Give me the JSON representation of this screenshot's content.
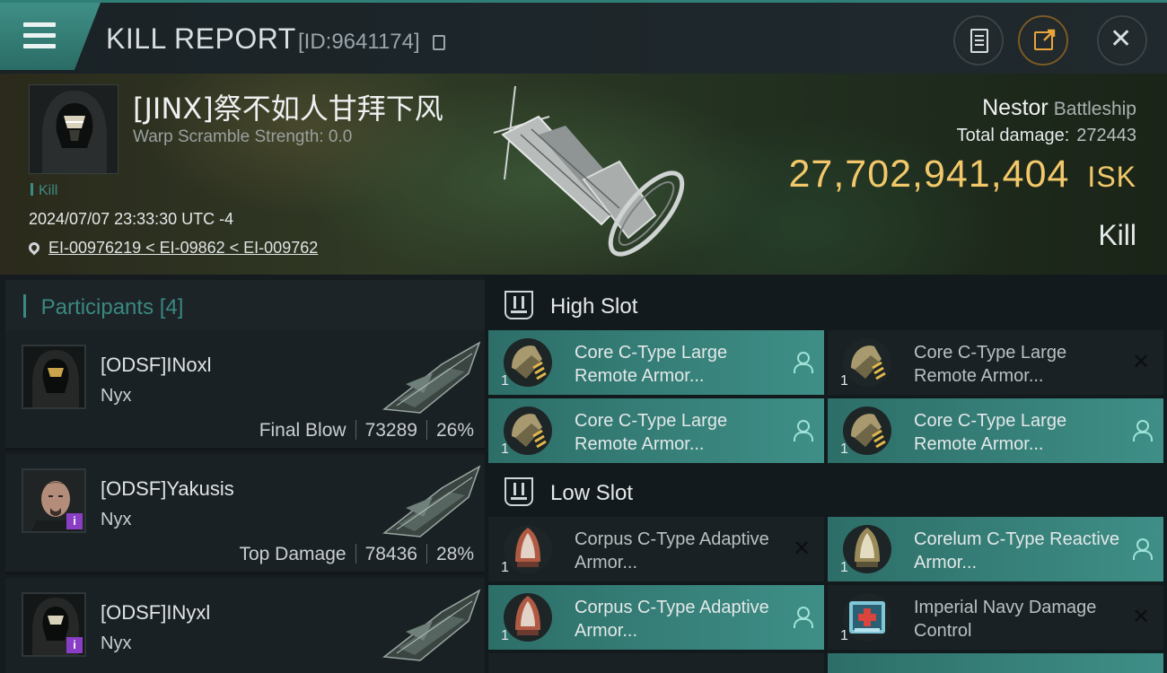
{
  "header": {
    "title": "KILL REPORT",
    "report_id": "[ID:9641174]"
  },
  "victim": {
    "name": "[JINX]祭不如人甘拜下风",
    "warp_scramble": "Warp Scramble Strength: 0.0",
    "tag": "Kill",
    "datetime": "2024/07/07 23:33:30 UTC -4",
    "location": "EI-00976219 < EI-09862 < EI-009762",
    "ship_name": "Nestor",
    "ship_class": "Battleship",
    "total_damage_label": "Total damage:",
    "total_damage": "272443",
    "isk_value": "27,702,941,404",
    "isk_unit": "ISK",
    "result": "Kill"
  },
  "participants": {
    "label": "Participants",
    "count": "[4]",
    "rows": [
      {
        "name": "[ODSF]INoxl",
        "ship": "Nyx",
        "role": "Final Blow",
        "damage": "73289",
        "percent": "26%"
      },
      {
        "name": "[ODSF]Yakusis",
        "ship": "Nyx",
        "role": "Top Damage",
        "damage": "78436",
        "percent": "28%"
      },
      {
        "name": "[ODSF]INyxl",
        "ship": "Nyx",
        "role": "",
        "damage": "",
        "percent": ""
      }
    ]
  },
  "fitting": {
    "high_slot_label": "High Slot",
    "low_slot_label": "Low Slot",
    "high": [
      {
        "name": "Core C-Type Large Remote Armor...",
        "qty": "1",
        "status": "person-icon"
      },
      {
        "name": "Core C-Type Large Remote Armor...",
        "qty": "1",
        "status": "dropped-x-icon"
      },
      {
        "name": "Core C-Type Large Remote Armor...",
        "qty": "1",
        "status": "person-icon"
      },
      {
        "name": "Core C-Type Large Remote Armor...",
        "qty": "1",
        "status": "person-icon"
      }
    ],
    "low": [
      {
        "name": "Corpus C-Type Adaptive Armor...",
        "qty": "1",
        "status": "dropped-x-icon"
      },
      {
        "name": "Corelum C-Type Reactive Armor...",
        "qty": "1",
        "status": "person-icon"
      },
      {
        "name": "Corpus C-Type Adaptive Armor...",
        "qty": "1",
        "status": "person-icon"
      },
      {
        "name": "Imperial Navy Damage Control",
        "qty": "1",
        "status": "dropped-x-icon"
      }
    ]
  },
  "colors": {
    "accent_teal": "#3e8f87",
    "isk_gold": "#f2c86a",
    "share_orange": "#e9a53a",
    "badge_purple": "#8a3ec6"
  }
}
